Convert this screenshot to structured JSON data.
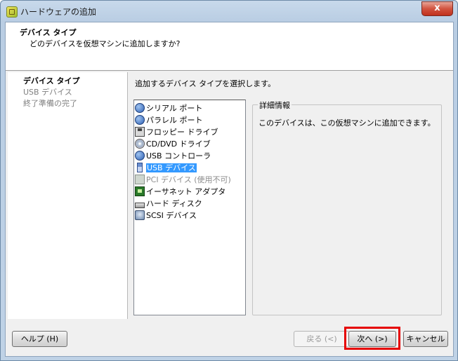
{
  "window": {
    "title": "ハードウェアの追加",
    "close_glyph": "x"
  },
  "header": {
    "title": "デバイス タイプ",
    "subtitle": "どのデバイスを仮想マシンに追加しますか?"
  },
  "steps": [
    {
      "label": "デバイス タイプ",
      "state": "active"
    },
    {
      "label": "USB デバイス",
      "state": "inactive"
    },
    {
      "label": "終了準備の完了",
      "state": "inactive"
    }
  ],
  "content": {
    "instruction": "追加するデバイス タイプを選択します。",
    "device_types": [
      {
        "label": "シリアル ポート",
        "icon": "serial-port-icon",
        "state": "normal"
      },
      {
        "label": "パラレル ポート",
        "icon": "parallel-port-icon",
        "state": "normal"
      },
      {
        "label": "フロッピー ドライブ",
        "icon": "floppy-drive-icon",
        "state": "normal"
      },
      {
        "label": "CD/DVD ドライブ",
        "icon": "cd-dvd-drive-icon",
        "state": "normal"
      },
      {
        "label": "USB コントローラ",
        "icon": "usb-controller-icon",
        "state": "normal"
      },
      {
        "label": "USB デバイス",
        "icon": "usb-device-icon",
        "state": "selected"
      },
      {
        "label": "PCI デバイス (使用不可)",
        "icon": "pci-device-icon",
        "state": "disabled"
      },
      {
        "label": "イーサネット アダプタ",
        "icon": "ethernet-adapter-icon",
        "state": "normal"
      },
      {
        "label": "ハード ディスク",
        "icon": "hard-disk-icon",
        "state": "normal"
      },
      {
        "label": "SCSI デバイス",
        "icon": "scsi-device-icon",
        "state": "normal"
      }
    ],
    "details": {
      "legend": "詳細情報",
      "text": "このデバイスは、この仮想マシンに追加できます。"
    }
  },
  "footer": {
    "help_label": "ヘルプ (H)",
    "back_label": "戻る (<)",
    "next_label": "次へ (>)",
    "cancel_label": "キャンセル"
  },
  "colors": {
    "selection": "#3399ff",
    "highlight_box": "#e60000"
  }
}
